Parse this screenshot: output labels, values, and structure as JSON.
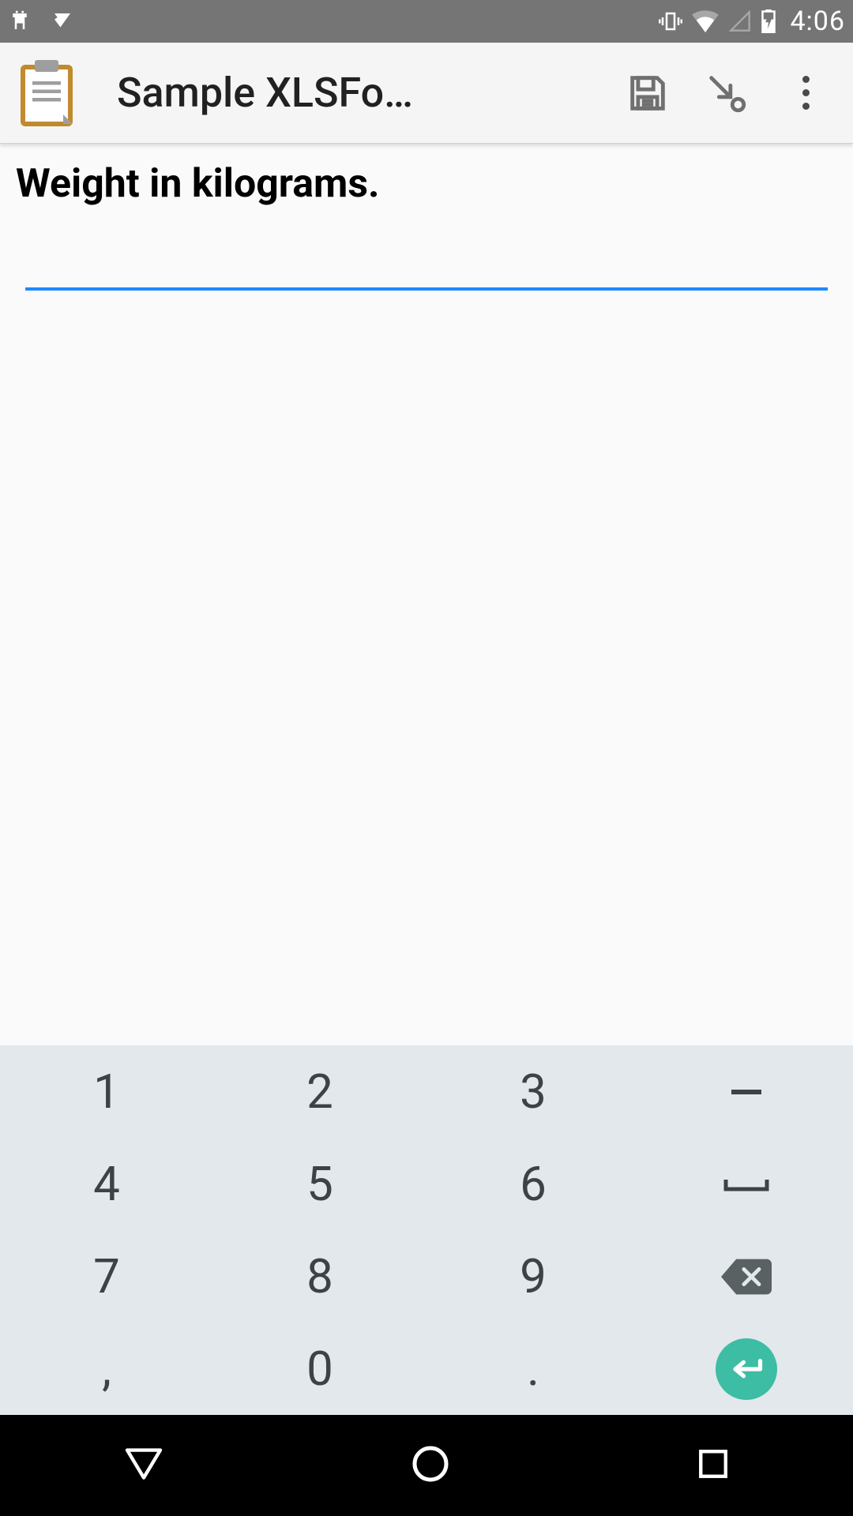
{
  "statusbar": {
    "clock": "4:06"
  },
  "appbar": {
    "title": "Sample XLSFo…"
  },
  "form": {
    "prompt": "Weight in kilograms.",
    "value": ""
  },
  "keyboard": {
    "rows": [
      [
        "1",
        "2",
        "3",
        "–"
      ],
      [
        "4",
        "5",
        "6",
        "⌴"
      ],
      [
        "7",
        "8",
        "9",
        "⌫"
      ],
      [
        ",",
        "0",
        ".",
        "↵"
      ]
    ]
  }
}
